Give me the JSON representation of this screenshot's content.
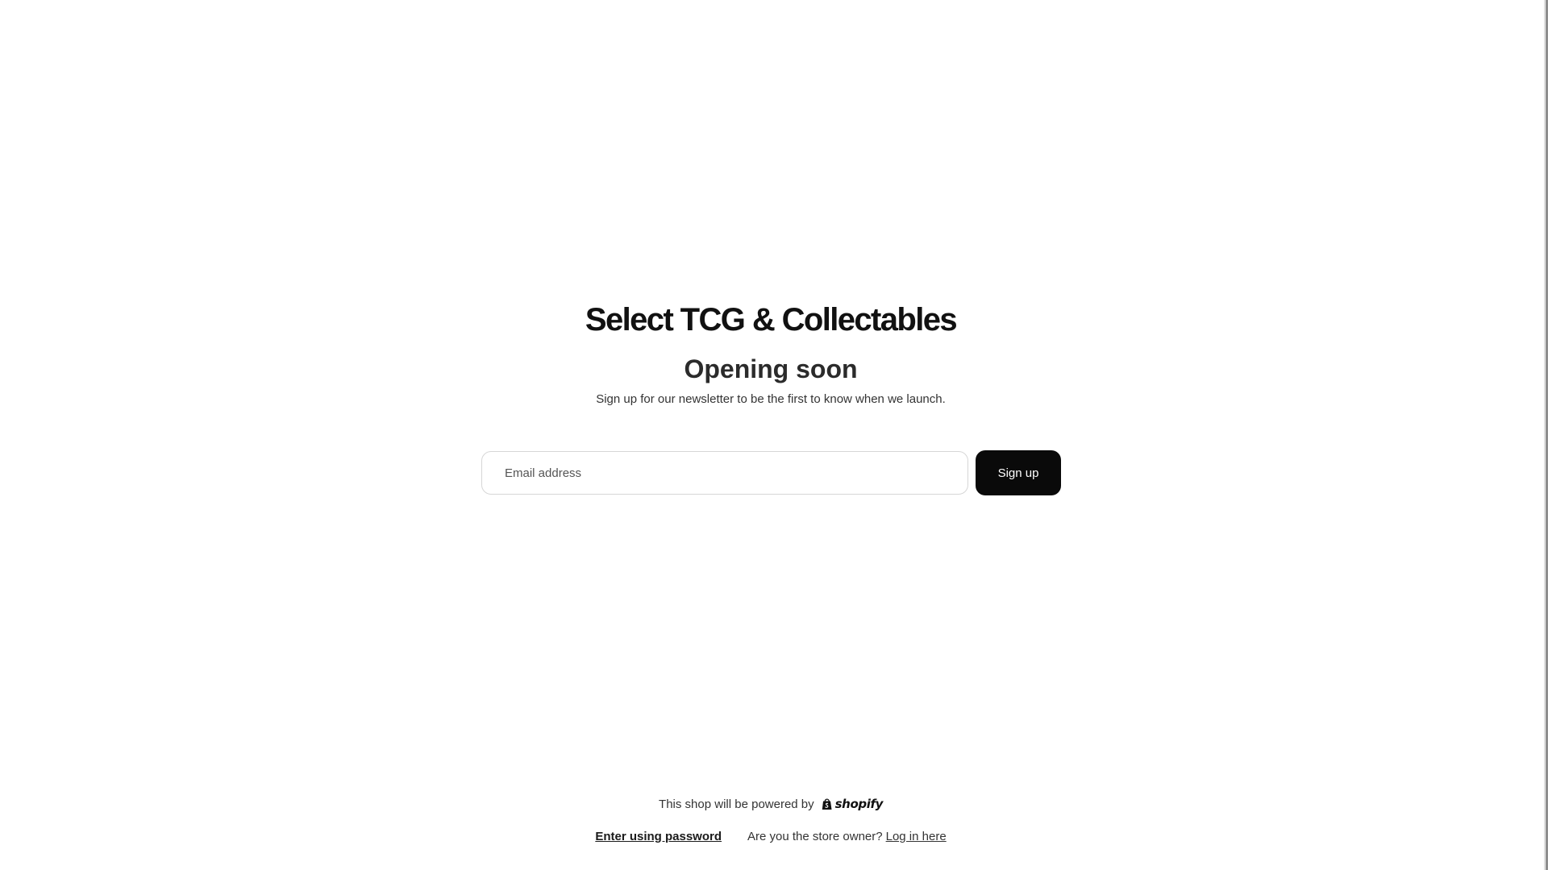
{
  "store": {
    "name": "Select TCG & Collectables"
  },
  "hero": {
    "heading": "Opening soon",
    "subtext": "Sign up for our newsletter to be the first to know when we launch."
  },
  "signup": {
    "email_placeholder": "Email address",
    "email_value": "",
    "button_label": "Sign up"
  },
  "footer": {
    "powered_text": "This shop will be powered by",
    "brand_name": "shopify",
    "enter_password_label": "Enter using password",
    "owner_question": "Are you the store owner?",
    "login_label": "Log in here"
  },
  "icons": {
    "brand_logo": "shopify-bag-icon"
  },
  "colors": {
    "button_bg": "#0a0a0a",
    "button_text": "#ffffff",
    "heading": "#111111",
    "border": "#d6d6d6"
  }
}
